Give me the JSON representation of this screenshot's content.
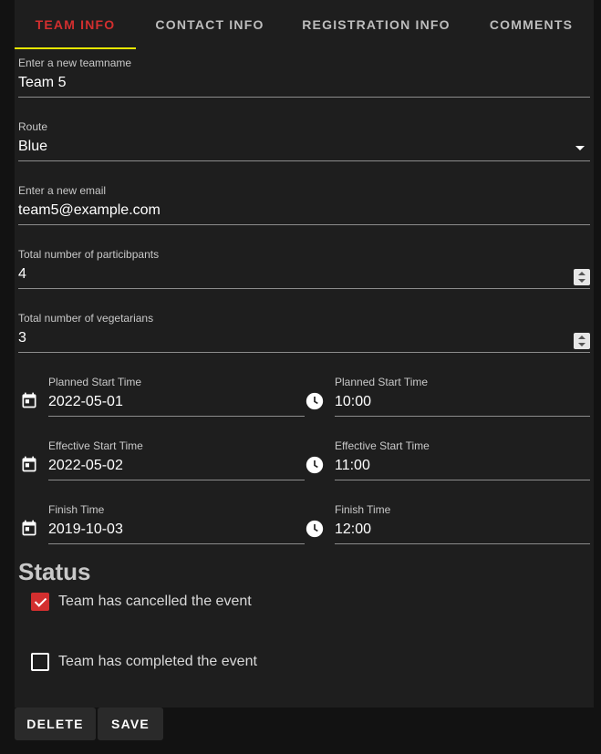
{
  "tabs": [
    {
      "label": "TEAM INFO",
      "active": true
    },
    {
      "label": "CONTACT INFO",
      "active": false
    },
    {
      "label": "REGISTRATION INFO",
      "active": false
    },
    {
      "label": "COMMENTS",
      "active": false
    }
  ],
  "form": {
    "teamname": {
      "label": "Enter a new teamname",
      "value": "Team 5"
    },
    "route": {
      "label": "Route",
      "value": "Blue"
    },
    "email": {
      "label": "Enter a new email",
      "value": "team5@example.com"
    },
    "participants": {
      "label": "Total number of particibpants",
      "value": "4"
    },
    "vegetarians": {
      "label": "Total number of vegetarians",
      "value": "3"
    },
    "planned_date": {
      "label": "Planned Start Time",
      "value": "2022-05-01"
    },
    "planned_time": {
      "label": "Planned Start Time",
      "value": "10:00"
    },
    "effective_date": {
      "label": "Effective Start Time",
      "value": "2022-05-02"
    },
    "effective_time": {
      "label": "Effective Start Time",
      "value": "11:00"
    },
    "finish_date": {
      "label": "Finish Time",
      "value": "2019-10-03"
    },
    "finish_time": {
      "label": "Finish Time",
      "value": "12:00"
    }
  },
  "status": {
    "title": "Status",
    "cancelled": {
      "label": "Team has cancelled the event",
      "checked": true
    },
    "completed": {
      "label": "Team has completed the event",
      "checked": false
    }
  },
  "actions": {
    "delete_label": "DELETE",
    "save_label": "SAVE"
  },
  "icons": {
    "date": "calendar-icon",
    "time": "clock-icon",
    "dropdown": "chevron-down-icon"
  },
  "colors": {
    "accent_red": "#d32f2f",
    "tab_indicator": "#e6e600",
    "background": "#121212",
    "card": "#1e1e1e"
  }
}
